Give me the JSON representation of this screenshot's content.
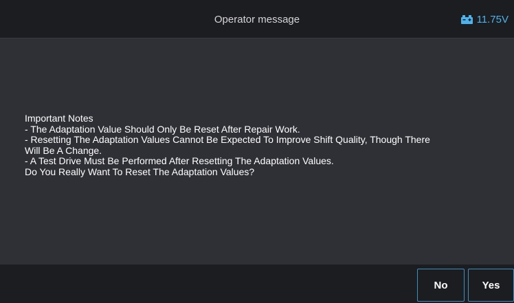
{
  "header": {
    "title": "Operator message",
    "battery_icon": "car-battery-icon",
    "battery_value": "11.75V",
    "accent_color": "#4db3ee"
  },
  "message": {
    "lines": [
      "Important Notes",
      "- The Adaptation Value Should Only Be Reset After Repair Work.",
      "- Resetting The Adaptation Values Cannot Be Expected To Improve Shift Quality, Though There",
      "Will Be A Change.",
      "- A Test Drive Must Be Performed After Resetting The Adaptation Values.",
      "Do You Really Want To Reset The Adaptation Values?"
    ]
  },
  "buttons": {
    "no_label": "No",
    "yes_label": "Yes"
  }
}
